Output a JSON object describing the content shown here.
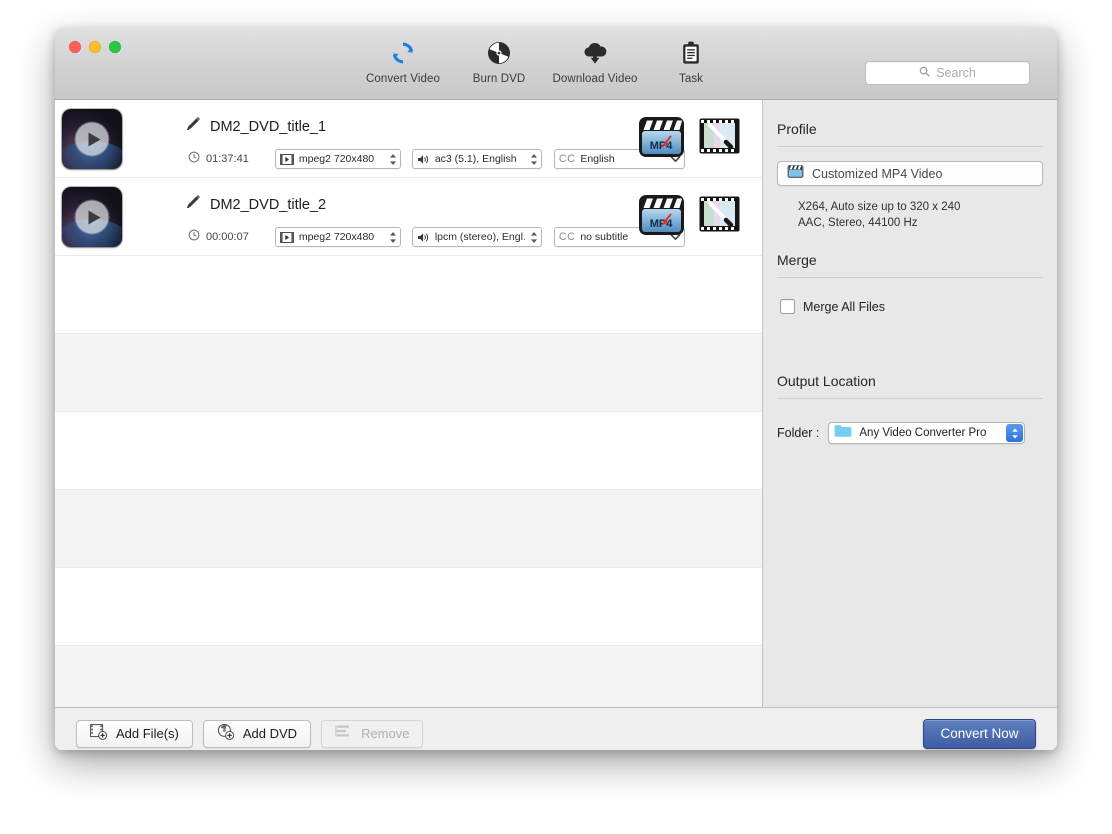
{
  "window": {
    "traffic_lights": [
      "close",
      "minimize",
      "zoom"
    ]
  },
  "toolbar": {
    "items": [
      {
        "label": "Convert Video",
        "icon": "convert-video-icon"
      },
      {
        "label": "Burn DVD",
        "icon": "burn-dvd-icon"
      },
      {
        "label": "Download Video",
        "icon": "download-video-icon"
      },
      {
        "label": "Task",
        "icon": "task-icon"
      }
    ],
    "search": {
      "placeholder": "Search",
      "value": "",
      "icon": "search-icon"
    }
  },
  "file_list": {
    "rows": [
      {
        "name": "DM2_DVD_title_1",
        "duration": "01:37:41",
        "video": "mpeg2 720x480",
        "audio": "ac3 (5.1), English",
        "subtitle_prefix": "CC",
        "subtitle": "English",
        "output_format_icon": "mp4-clapperboard-icon",
        "edit_icon": "film-wand-edit-icon"
      },
      {
        "name": "DM2_DVD_title_2",
        "duration": "00:00:07",
        "video": "mpeg2 720x480",
        "audio": "lpcm (stereo), Engl…",
        "subtitle_prefix": "CC",
        "subtitle": "no subtitle",
        "output_format_icon": "mp4-clapperboard-icon",
        "edit_icon": "film-wand-edit-icon"
      }
    ],
    "empty_stripe_count": 6
  },
  "sidebar": {
    "profile": {
      "heading": "Profile",
      "selected": "Customized MP4 Video",
      "details_line1": "X264, Auto size up to 320 x 240",
      "details_line2": "AAC, Stereo, 44100 Hz"
    },
    "merge": {
      "heading": "Merge",
      "checkbox_label": "Merge All Files",
      "checked": false
    },
    "output_location": {
      "heading": "Output Location",
      "folder_label": "Folder :",
      "folder_value": "Any Video Converter Pro"
    }
  },
  "bottom_bar": {
    "add_files_label": "Add File(s)",
    "add_dvd_label": "Add DVD",
    "remove_label": "Remove",
    "remove_disabled": true,
    "convert_label": "Convert Now"
  },
  "colors": {
    "accent_blue": "#2f72de",
    "convert_button": "#3e5ca4",
    "toolbar_icon_blue": "#1e7fe0",
    "sidebar_bg": "#e8e8e8"
  }
}
